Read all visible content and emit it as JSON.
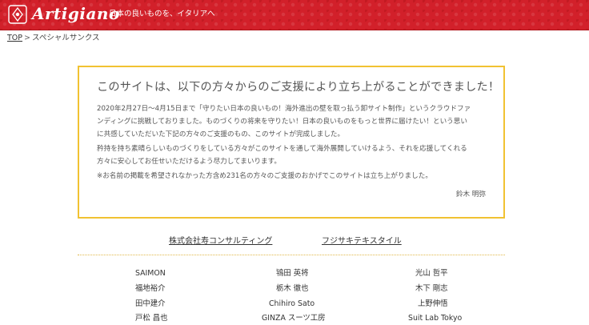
{
  "header": {
    "logo_text": "Artigiano",
    "tagline": "日本の良いものを、イタリアへ",
    "background_color": "#d2202a"
  },
  "breadcrumb": {
    "home": "TOP",
    "separator": ">",
    "current": "スペシャルサンクス"
  },
  "thanks": {
    "title": "このサイトは、以下の方々からのご支援により立ち上がることができました！",
    "paragraph_1_line_1": "2020年2月27日〜4月15日まで「守りたい日本の良いもの！海外進出の壁を取っ払う卸サイト制作」というクラウドファ",
    "paragraph_1_line_2": "ンディングに挑戦しておりました。ものづくりの将来を守りたい！日本の良いものをもっと世界に届けたい！という思い",
    "paragraph_1_line_3": "に共感していただいた下記の方々のご支援のもの、このサイトが完成しました。",
    "paragraph_2_line_1": "矜持を持ち素晴らしいものづくりをしている方々がこのサイトを通して海外展開していけるよう、それを応援してくれる",
    "paragraph_2_line_2": "方々に安心してお任せいただけるよう尽力してまいります。",
    "paragraph_3": "※お名前の掲載を希望されなかった方含め231名の方々のご支援のおかげでこのサイトは立ち上がりました。",
    "signature": "鈴木 明弥",
    "border_color": "#f1c232"
  },
  "sponsors": [
    "株式会社寿コンサルティング",
    "フジサキテキスタイル"
  ],
  "supporters": [
    "SAIMON",
    "鴇田 英将",
    "光山 哲平",
    "福地裕介",
    "栃木 徹也",
    "木下 剛志",
    "田中建介",
    "Chihiro Sato",
    "上野伸悟",
    "戸松 昌也",
    "GINZA スーツ工房",
    "Suit Lab Tokyo"
  ]
}
